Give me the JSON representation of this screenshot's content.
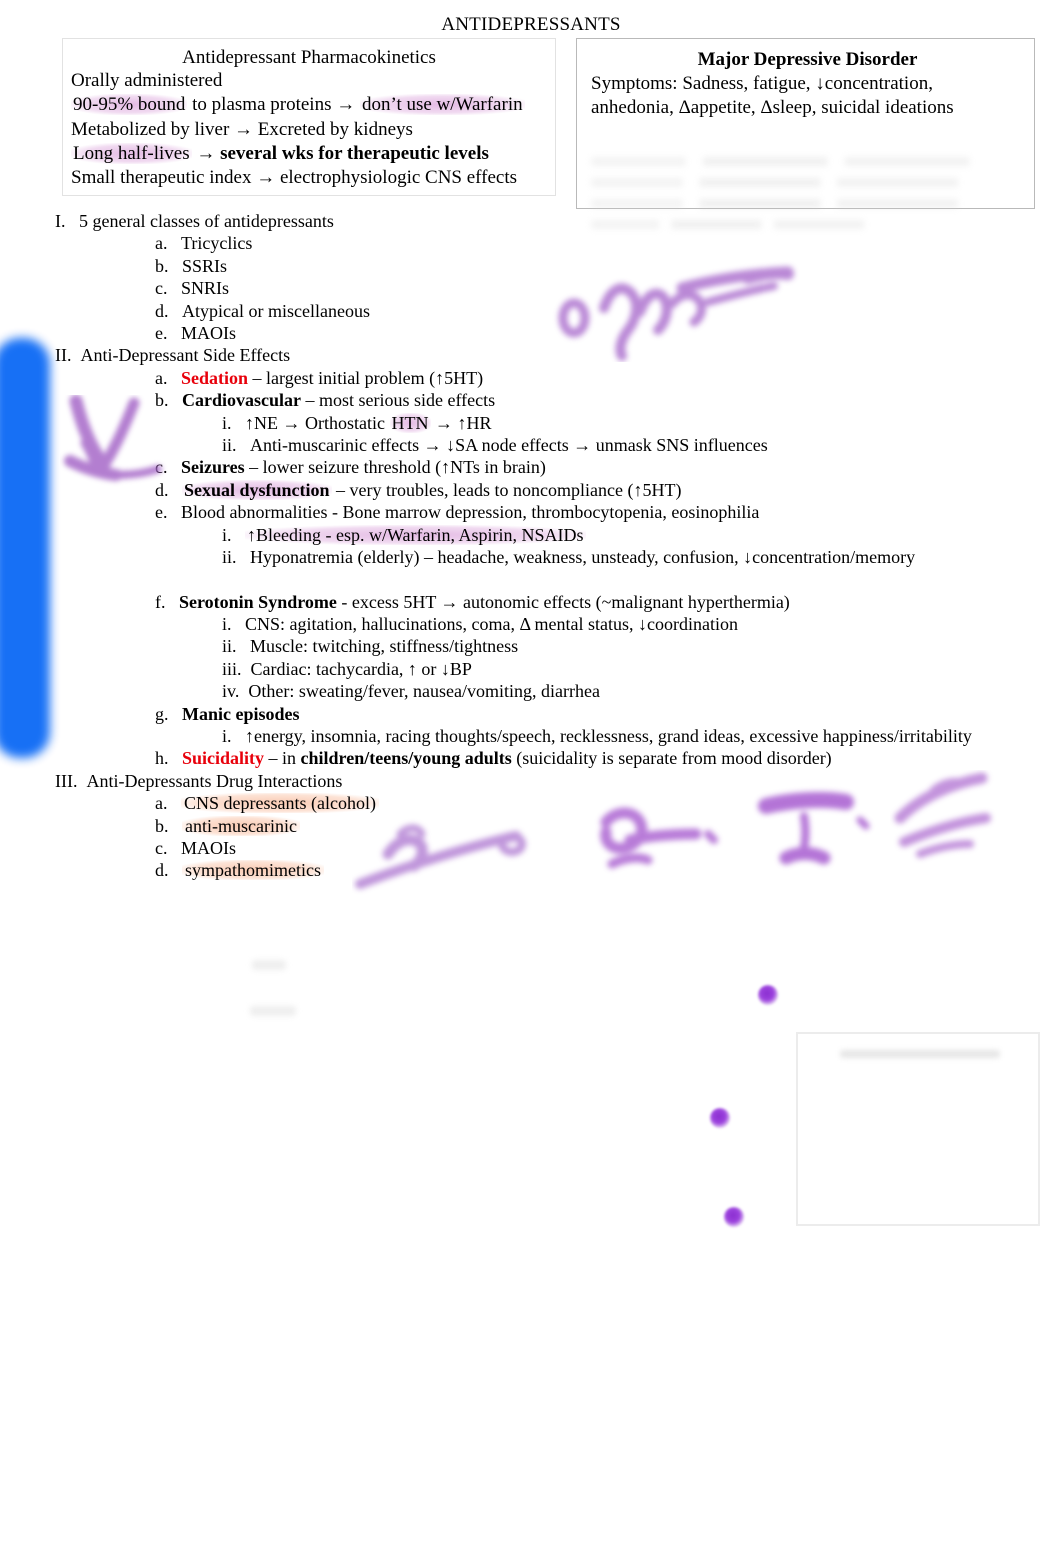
{
  "document": {
    "title": "ANTIDEPRESSANTS"
  },
  "pharmacokinetics_box": {
    "heading": "Antidepressant Pharmacokinetics",
    "lines": [
      {
        "text": "Orally administered",
        "highlight": "none"
      },
      {
        "text": "90-95% bound to plasma proteins → don’t use w/Warfarin",
        "highlight": "purple-partial"
      },
      {
        "text": "Metabolized by liver → Excreted by kidneys",
        "highlight": "none"
      },
      {
        "text": "Long half-lives → several wks for therapeutic levels",
        "highlight": "purple-partial"
      },
      {
        "text": "Small therapeutic index → electrophysiologic CNS effects",
        "highlight": "none"
      }
    ],
    "line2_part_a": "90-95% bound",
    "line2_part_b": " to plasma proteins → ",
    "line2_part_c": "don’t use w/Warfarin",
    "line4_part_a": "Long half-lives",
    "line4_part_b": " → ",
    "line4_part_c": "several wks for therapeutic levels"
  },
  "mdd_box": {
    "heading": "Major Depressive Disorder",
    "line1": "Symptoms: Sadness, fatigue, ↓concentration,",
    "line2": "anhedonia, Δappetite, Δsleep, suicidal ideations"
  },
  "outline": {
    "section_I": {
      "marker": "I.",
      "text": "5 general classes of antidepressants",
      "items": [
        {
          "marker": "a.",
          "text": "Tricyclics"
        },
        {
          "marker": "b.",
          "text": "SSRIs"
        },
        {
          "marker": "c.",
          "text": "SNRIs"
        },
        {
          "marker": "d.",
          "text": "Atypical or miscellaneous"
        },
        {
          "marker": "e.",
          "text": "MAOIs"
        }
      ]
    },
    "section_II": {
      "marker": "II.",
      "text": "Anti-Depressant Side Effects",
      "a": {
        "marker": "a.",
        "term": "Sedation",
        "rest": " – largest initial problem (↑5HT)"
      },
      "b": {
        "marker": "b.",
        "term": "Cardiovascular",
        "rest": " – most serious side effects",
        "i": {
          "marker": "i.",
          "pre": "↑NE → Orthostatic ",
          "hl": "HTN",
          "post": " → ↑HR"
        },
        "ii": {
          "marker": "ii.",
          "text": "Anti-muscarinic effects → ↓SA node effects → unmask SNS influences"
        }
      },
      "c": {
        "marker": "c.",
        "term": "Seizures",
        "rest": " – lower seizure threshold (↑NTs in brain)"
      },
      "d": {
        "marker": "d.",
        "term": "Sexual dysfunction",
        "rest": " – very troubles, leads to noncompliance (↑5HT)"
      },
      "e": {
        "marker": "e.",
        "term": "Blood abnormalities",
        "rest": "  - Bone marrow depression, thrombocytopenia, eosinophilia",
        "i": {
          "marker": "i.",
          "text": "↑Bleeding -  esp. w/Warfarin, Aspirin, NSAIDs"
        },
        "ii": {
          "marker": "ii.",
          "text": "Hyponatremia (elderly) – headache, weakness, unsteady, confusion, ↓concentration/memory"
        }
      },
      "f": {
        "marker": "f.",
        "term": "Serotonin Syndrome",
        "rest": "  - excess 5HT → autonomic effects (~malignant hyperthermia)",
        "i": {
          "marker": "i.",
          "text": "CNS: agitation, hallucinations, coma, Δ mental status, ↓coordination"
        },
        "ii": {
          "marker": "ii.",
          "text": "Muscle: twitching, stiffness/tightness"
        },
        "iii": {
          "marker": "iii.",
          "text": "Cardiac: tachycardia, ↑ or ↓BP"
        },
        "iv": {
          "marker": "iv.",
          "text": "Other: sweating/fever, nausea/vomiting, diarrhea"
        }
      },
      "g": {
        "marker": "g.",
        "term": "Manic episodes",
        "rest": "",
        "i": {
          "marker": "i.",
          "text": "↑energy, insomnia, racing thoughts/speech, recklessness, grand ideas, excessive happiness/irritability"
        }
      },
      "h": {
        "marker": "h.",
        "term": "Suicidality",
        "mid": " – in ",
        "bold2": "children/teens/young adults",
        "rest": " (suicidality is separate from mood disorder)"
      }
    },
    "section_III": {
      "marker": "III.",
      "text": "Anti-Depressants Drug Interactions",
      "items": [
        {
          "marker": "a.",
          "text": "CNS depressants (alcohol)",
          "highlight": "orange"
        },
        {
          "marker": "b.",
          "text": "anti-muscarinic",
          "highlight": "orange"
        },
        {
          "marker": "c.",
          "text": "MAOIs",
          "highlight": "none"
        },
        {
          "marker": "d.",
          "text": "sympathomimetics",
          "highlight": "orange-cutoff"
        }
      ]
    }
  },
  "annotations": {
    "blue_marker": {
      "label": "blue vertical highlighter stripe",
      "color": "#0b69f5"
    },
    "purple_ink_color": "#9c42de",
    "scrawls": [
      {
        "name": "purple-scrawl-top-right",
        "legible": false
      },
      {
        "name": "purple-scrawl-left-margin",
        "legible": false
      },
      {
        "name": "purple-scrawl-bottom",
        "legible": false
      }
    ],
    "dots": [
      {
        "name": "purple-dot-1"
      },
      {
        "name": "purple-dot-2"
      },
      {
        "name": "purple-dot-3"
      }
    ],
    "ghost_box": {
      "legible": false
    }
  }
}
